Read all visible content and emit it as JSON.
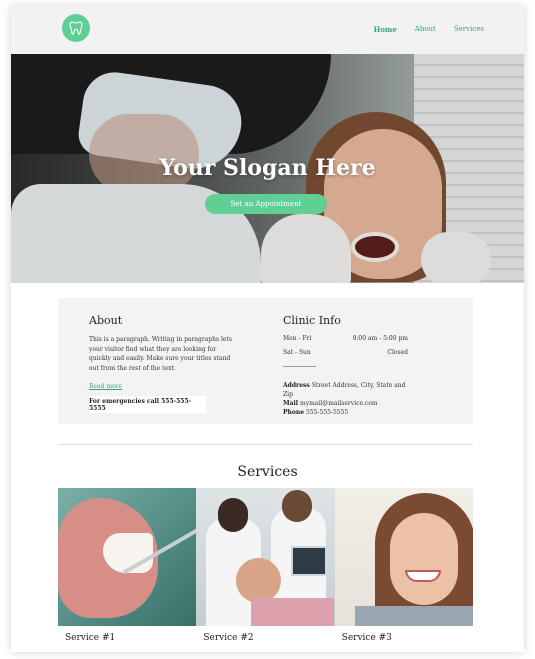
{
  "brand": {
    "logo_icon": "tooth-icon",
    "accent_color": "#5fcf93"
  },
  "nav": {
    "items": [
      "Home",
      "About",
      "Services"
    ],
    "active": "Home"
  },
  "hero": {
    "title": "Your Slogan Here",
    "button_label": "Set an Appointment"
  },
  "about": {
    "heading": "About",
    "paragraph": "This is a paragraph. Writing in paragraphs lets your visitor find what they are looking for quickly and easily. Make sure your titles stand out from the rest of the text.",
    "read_more": "Read more",
    "emergency": "For emergencies call 555-555-5555"
  },
  "clinic": {
    "heading": "Clinic Info",
    "hours": [
      {
        "days": "Mon - Fri",
        "time": "9:00 am - 5:00 pm"
      },
      {
        "days": "Sat - Sun",
        "time": "Closed"
      }
    ],
    "address_label": "Address",
    "address": "Street Address, City, State and Zip",
    "mail_label": "Mail",
    "mail": "mymail@mailservice.com",
    "phone_label": "Phone",
    "phone": "555-555-5555"
  },
  "services": {
    "title": "Services",
    "items": [
      {
        "label": "Service #1"
      },
      {
        "label": "Service #2"
      },
      {
        "label": "Service #3"
      }
    ]
  }
}
